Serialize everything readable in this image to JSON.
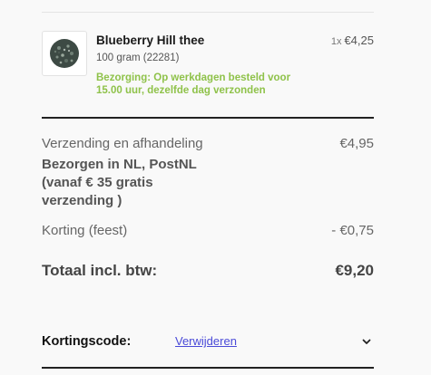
{
  "product": {
    "name": "Blueberry Hill thee",
    "variant": "100 gram (22281)",
    "delivery": "Bezorging: Op werkdagen besteld voor 15.00 uur, dezelfde dag verzonden",
    "quantity": "1x",
    "price": "€4,25",
    "image_icon": "tea-leaves-icon"
  },
  "summary": {
    "shipping_label": "Verzending en afhandeling",
    "shipping_value": "€4,95",
    "shipping_method": "Bezorgen in NL, PostNL (vanaf € 35 gratis verzending )",
    "discount_label": "Korting (feest)",
    "discount_value": "- €0,75",
    "total_label": "Totaal incl. btw:",
    "total_value": "€9,20"
  },
  "discount_code": {
    "label": "Kortingscode:",
    "remove_link": "Verwijderen",
    "toggle_icon": "chevron-down-icon"
  },
  "colors": {
    "delivery_green": "#8fc24a",
    "link_blue": "#4a4ad8",
    "background": "#f9f9f9"
  }
}
